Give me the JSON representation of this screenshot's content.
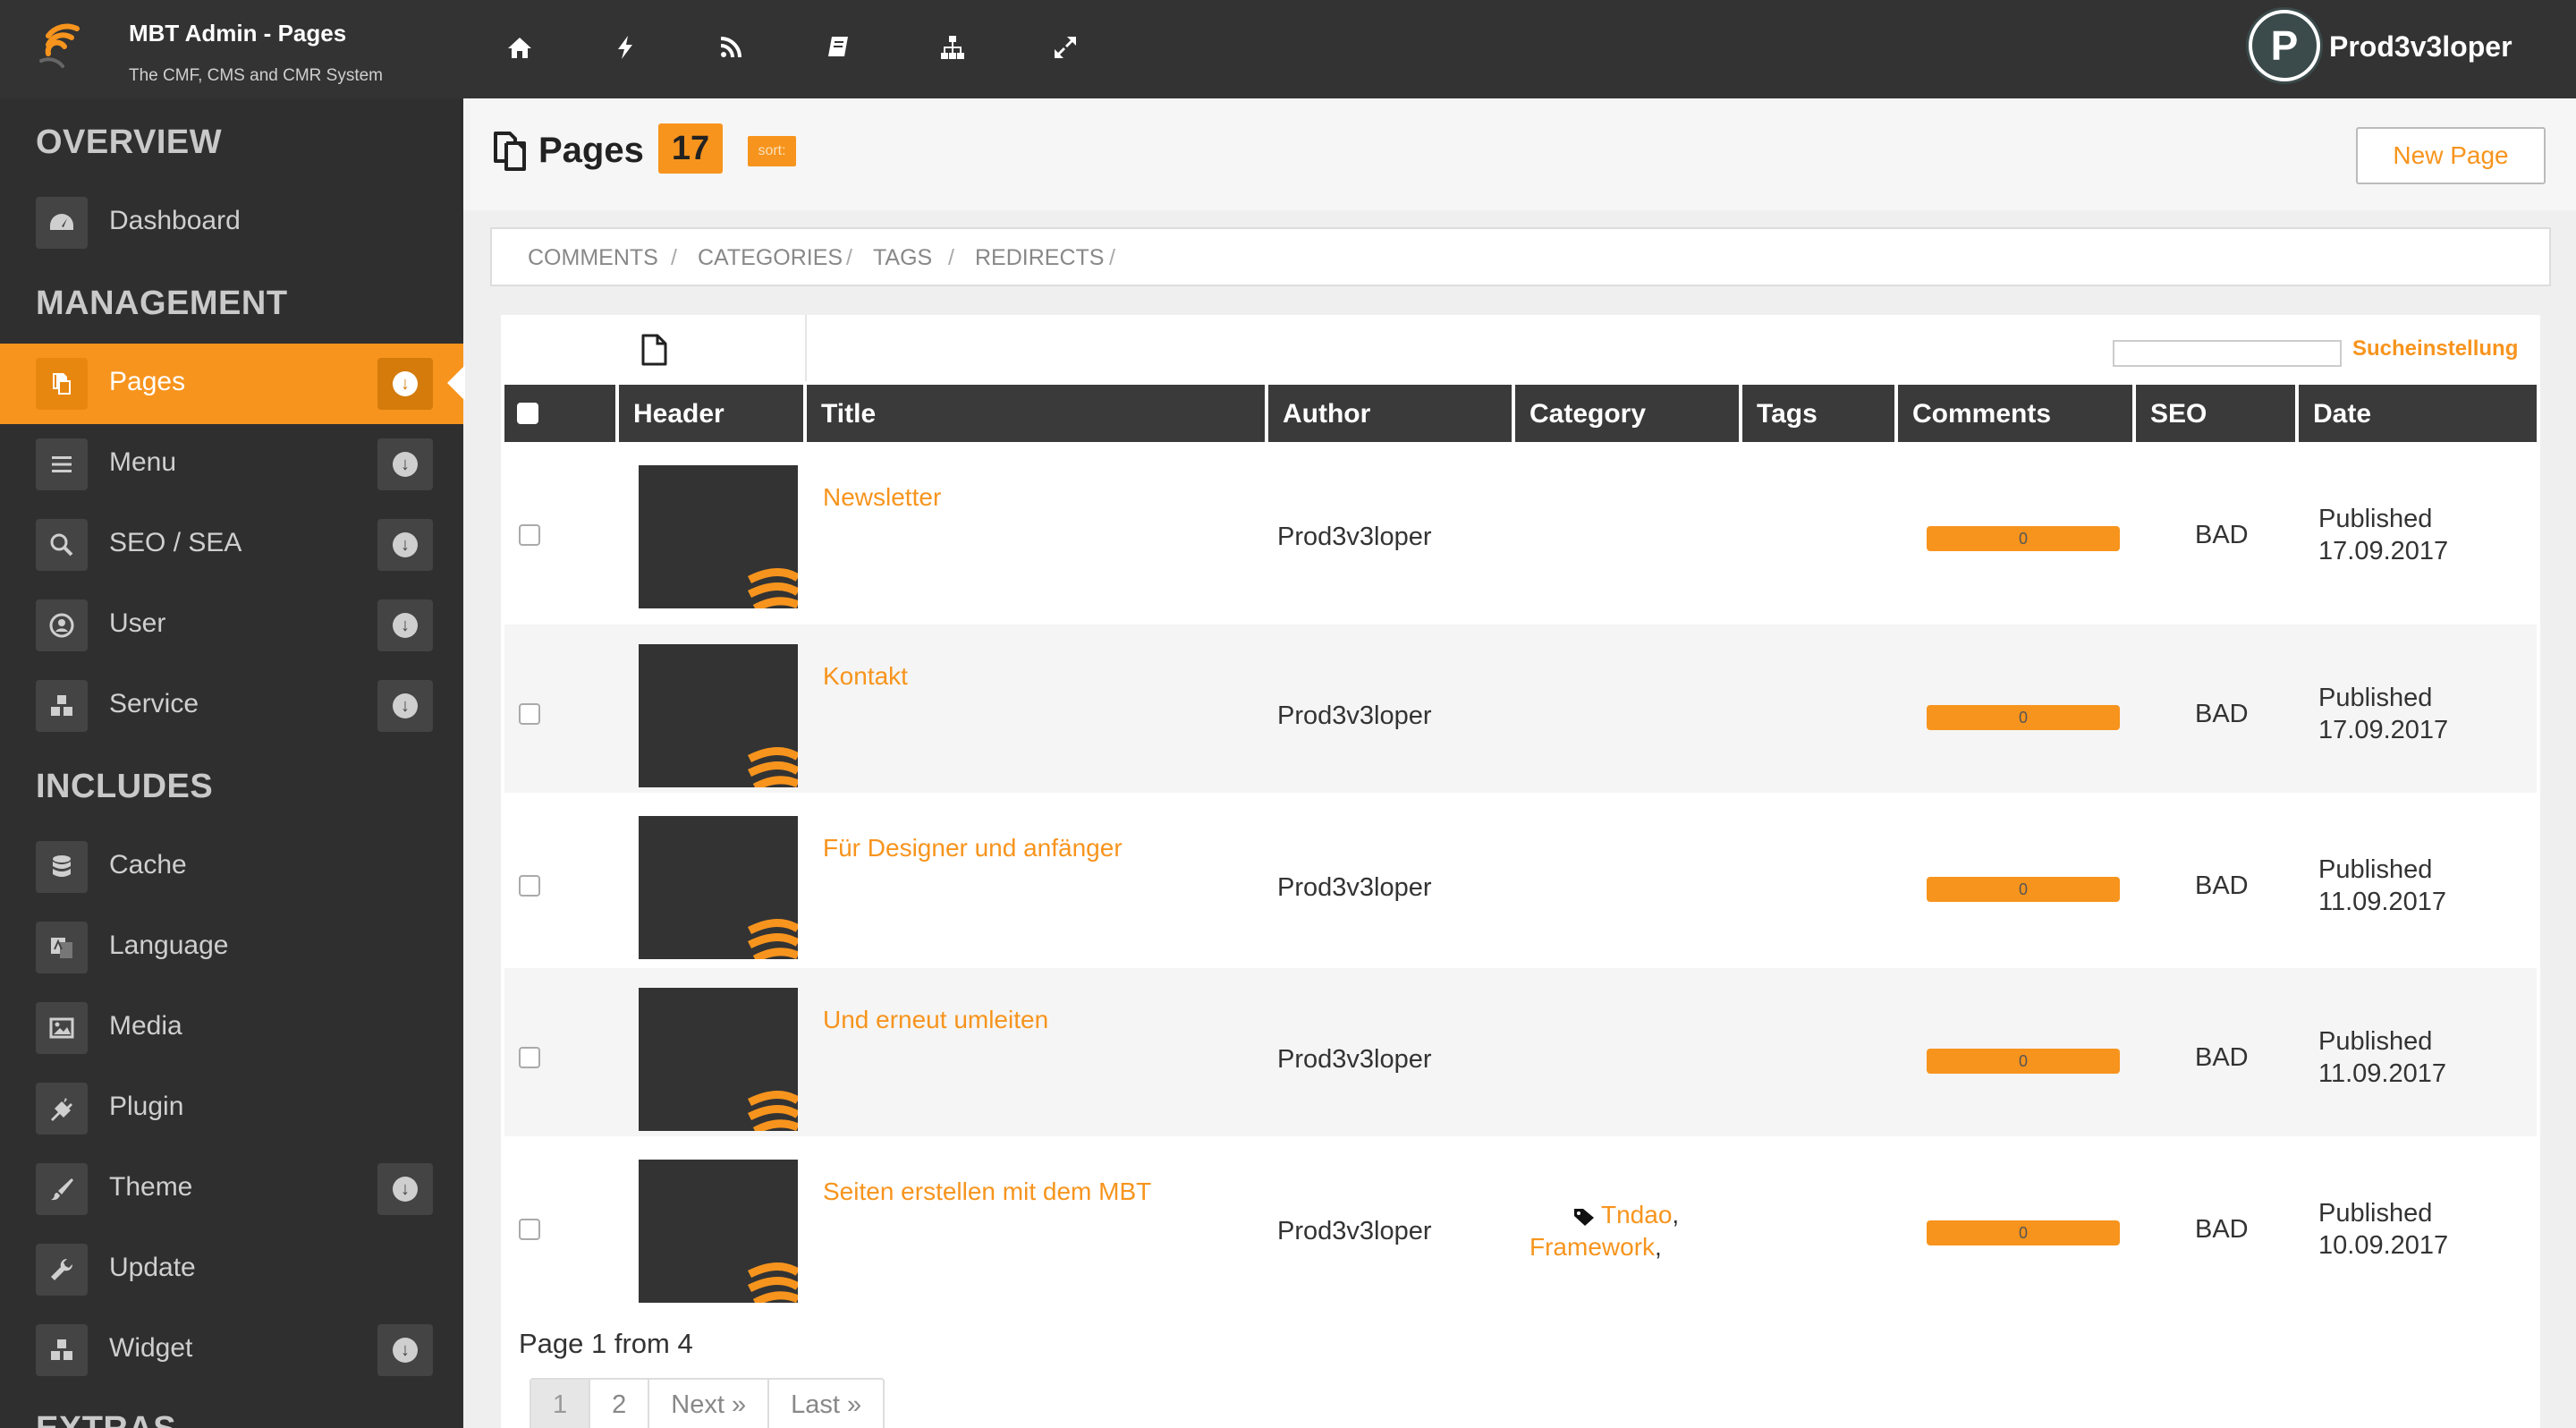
{
  "topbar": {
    "title": "MBT Admin - Pages",
    "subtitle": "The CMF, CMS and CMR System",
    "icons": [
      "home-icon",
      "bolt-icon",
      "rss-icon",
      "book-icon",
      "sitemap-icon",
      "expand-icon"
    ],
    "avatar_letter": "P",
    "user_name": "Prod3v3loper"
  },
  "sidebar": {
    "sections": {
      "overview": "OVERVIEW",
      "management": "MANAGEMENT",
      "includes": "INCLUDES",
      "extras": "EXTRAS"
    },
    "items": [
      {
        "label": "Dashboard",
        "icon": "dashboard-icon"
      },
      {
        "label": "Pages",
        "icon": "pages-icon",
        "active": true
      },
      {
        "label": "Menu",
        "icon": "menu-icon"
      },
      {
        "label": "SEO / SEA",
        "icon": "search-icon"
      },
      {
        "label": "User",
        "icon": "user-icon"
      },
      {
        "label": "Service",
        "icon": "cubes-icon"
      },
      {
        "label": "Cache",
        "icon": "database-icon"
      },
      {
        "label": "Language",
        "icon": "language-icon"
      },
      {
        "label": "Media",
        "icon": "image-icon"
      },
      {
        "label": "Plugin",
        "icon": "plug-icon"
      },
      {
        "label": "Theme",
        "icon": "brush-icon"
      },
      {
        "label": "Update",
        "icon": "wrench-icon"
      },
      {
        "label": "Widget",
        "icon": "cubes-icon"
      }
    ],
    "expand_symbol": "↓"
  },
  "page": {
    "title": "Pages",
    "count": "17",
    "sort_label": "sort:",
    "new_button": "New Page"
  },
  "subnav": [
    "COMMENTS",
    "CATEGORIES",
    "TAGS",
    "REDIRECTS"
  ],
  "subnav_sep": "/",
  "search": {
    "placeholder": "",
    "settings_label": "Sucheinstellung"
  },
  "table": {
    "columns": [
      "Header",
      "Title",
      "Author",
      "Category",
      "Tags",
      "Comments",
      "SEO",
      "Date"
    ],
    "rows": [
      {
        "title": "Newsletter",
        "author": "Prod3v3loper",
        "categories": [],
        "comments": "0",
        "seo": "BAD",
        "status": "Published",
        "date": "17.09.2017"
      },
      {
        "title": "Kontakt",
        "author": "Prod3v3loper",
        "categories": [],
        "comments": "0",
        "seo": "BAD",
        "status": "Published",
        "date": "17.09.2017"
      },
      {
        "title": "Für Designer und anfänger",
        "author": "Prod3v3loper",
        "categories": [],
        "comments": "0",
        "seo": "BAD",
        "status": "Published",
        "date": "11.09.2017"
      },
      {
        "title": "Und erneut umleiten",
        "author": "Prod3v3loper",
        "categories": [],
        "comments": "0",
        "seo": "BAD",
        "status": "Published",
        "date": "11.09.2017"
      },
      {
        "title": "Seiten erstellen mit dem MBT",
        "author": "Prod3v3loper",
        "categories": [
          "Tndao",
          "Framework"
        ],
        "comments": "0",
        "seo": "BAD",
        "status": "Published",
        "date": "10.09.2017"
      }
    ]
  },
  "pagination": {
    "info": "Page 1 from 4",
    "pages": [
      "1",
      "2",
      "Next »",
      "Last »"
    ]
  },
  "colors": {
    "accent": "#f7941d",
    "topbar": "#333333",
    "sidebar": "#2f2f2f",
    "table_header": "#3a3a3a"
  }
}
